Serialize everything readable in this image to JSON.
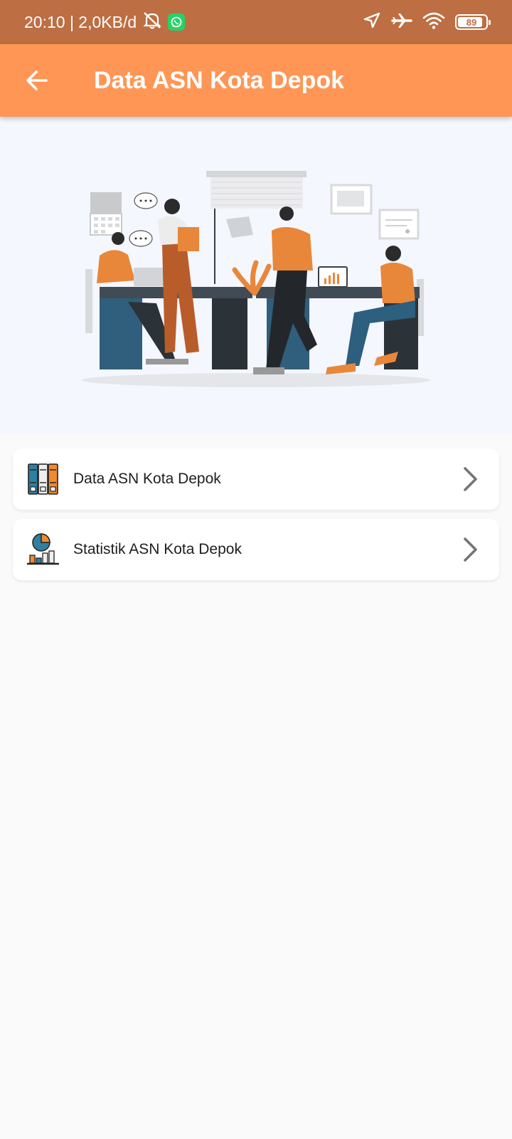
{
  "status_bar": {
    "time_network": "20:10 | 2,0KB/d",
    "battery": "89",
    "icons": [
      "bell-off-icon",
      "whatsapp-icon",
      "location-icon",
      "airplane-icon",
      "wifi-icon",
      "battery-icon"
    ]
  },
  "app_bar": {
    "title": "Data ASN Kota Depok",
    "back_icon": "arrow-left-icon",
    "background": "#ff9655"
  },
  "hero": {
    "illustration": "office-team-illustration"
  },
  "menu": {
    "items": [
      {
        "label": "Data ASN Kota Depok",
        "icon": "binders-icon"
      },
      {
        "label": "Statistik ASN Kota Depok",
        "icon": "statistics-chart-icon"
      }
    ]
  },
  "colors": {
    "status_bar": "#bd6e43",
    "accent": "#ff9655",
    "hero_background": "#f4f7fd",
    "page_background": "#fafafa"
  }
}
